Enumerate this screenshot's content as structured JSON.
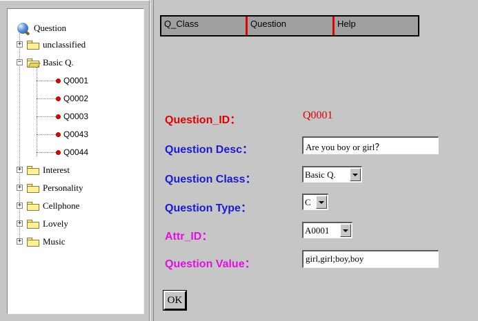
{
  "tree": {
    "root_label": "Question",
    "folders": [
      {
        "label": "unclassified",
        "expanded": false
      },
      {
        "label": "Basic Q.",
        "expanded": true,
        "items": [
          "Q0001",
          "Q0002",
          "Q0003",
          "Q0043",
          "Q0044"
        ]
      },
      {
        "label": "Interest",
        "expanded": false
      },
      {
        "label": "Personality",
        "expanded": false
      },
      {
        "label": "Cellphone",
        "expanded": false
      },
      {
        "label": "Lovely",
        "expanded": false
      },
      {
        "label": "Music",
        "expanded": false
      }
    ],
    "expander_collapsed": "+",
    "expander_expanded": "−"
  },
  "tabs": [
    "Q_Class",
    "Question",
    "Help"
  ],
  "form": {
    "id_label": "Question_ID：",
    "id_value": "Q0001",
    "desc_label": "Question Desc：",
    "desc_value": "Are you boy or girl？",
    "class_label": "Question Class：",
    "class_value": "Basic Q.",
    "type_label": "Question Type：",
    "type_value": "C",
    "attr_label": "Attr_ID：",
    "attr_value": "A0001",
    "value_label": "Question Value：",
    "value_value": "girl,girl;boy,boy",
    "ok_label": "OK"
  },
  "colors": {
    "red": "#e00000",
    "blue": "#1a1ad0",
    "magenta": "#e010e0",
    "frame_gray": "#c6c6c6"
  }
}
